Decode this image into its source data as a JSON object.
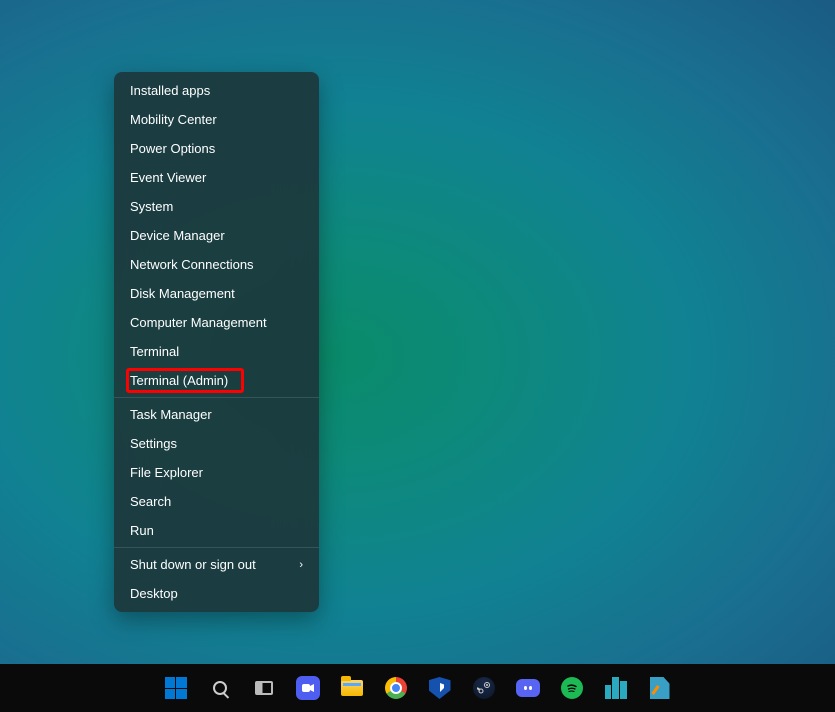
{
  "context_menu": {
    "groups": [
      [
        {
          "label": "Installed apps",
          "name": "menu-installed-apps"
        },
        {
          "label": "Mobility Center",
          "name": "menu-mobility-center"
        },
        {
          "label": "Power Options",
          "name": "menu-power-options"
        },
        {
          "label": "Event Viewer",
          "name": "menu-event-viewer"
        },
        {
          "label": "System",
          "name": "menu-system"
        },
        {
          "label": "Device Manager",
          "name": "menu-device-manager"
        },
        {
          "label": "Network Connections",
          "name": "menu-network-connections"
        },
        {
          "label": "Disk Management",
          "name": "menu-disk-management"
        },
        {
          "label": "Computer Management",
          "name": "menu-computer-management"
        },
        {
          "label": "Terminal",
          "name": "menu-terminal"
        },
        {
          "label": "Terminal (Admin)",
          "name": "menu-terminal-admin",
          "highlighted": true
        }
      ],
      [
        {
          "label": "Task Manager",
          "name": "menu-task-manager"
        },
        {
          "label": "Settings",
          "name": "menu-settings"
        },
        {
          "label": "File Explorer",
          "name": "menu-file-explorer"
        },
        {
          "label": "Search",
          "name": "menu-search"
        },
        {
          "label": "Run",
          "name": "menu-run"
        }
      ],
      [
        {
          "label": "Shut down or sign out",
          "name": "menu-shutdown",
          "submenu": true
        },
        {
          "label": "Desktop",
          "name": "menu-desktop"
        }
      ]
    ]
  },
  "taskbar": {
    "items": [
      {
        "name": "start-button"
      },
      {
        "name": "search-button"
      },
      {
        "name": "task-view-button"
      },
      {
        "name": "chat-app"
      },
      {
        "name": "file-explorer-app"
      },
      {
        "name": "chrome-app"
      },
      {
        "name": "bitwarden-app"
      },
      {
        "name": "steam-app"
      },
      {
        "name": "discord-app"
      },
      {
        "name": "spotify-app"
      },
      {
        "name": "cities-app"
      },
      {
        "name": "editor-app"
      }
    ]
  },
  "highlight_color": "#ff0000"
}
